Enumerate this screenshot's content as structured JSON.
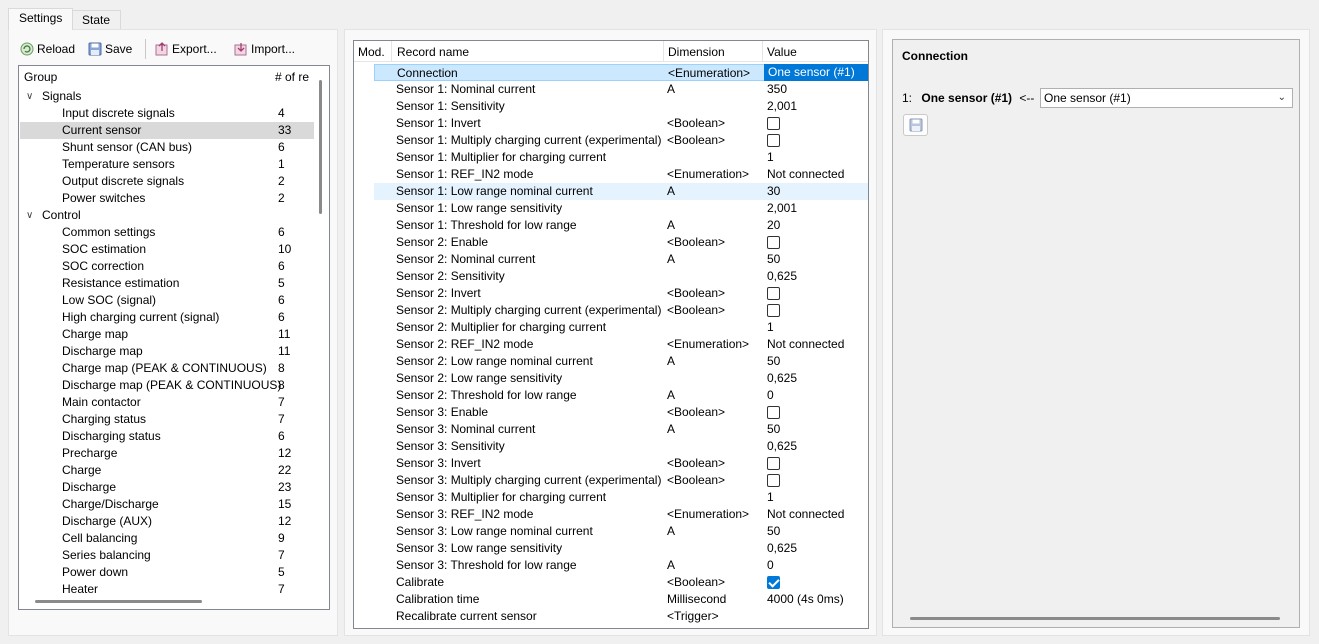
{
  "tabs": [
    {
      "label": "Settings",
      "active": true
    },
    {
      "label": "State",
      "active": false
    }
  ],
  "toolbar": {
    "reload": "Reload",
    "save": "Save",
    "export": "Export...",
    "import": "Import..."
  },
  "tree": {
    "col_group": "Group",
    "col_count": "# of re",
    "rows": [
      {
        "label": "Signals",
        "count": "",
        "level": 0,
        "expanded": true
      },
      {
        "label": "Input discrete signals",
        "count": "4",
        "level": 1
      },
      {
        "label": "Current sensor",
        "count": "33",
        "level": 1,
        "selected": true
      },
      {
        "label": "Shunt sensor (CAN bus)",
        "count": "6",
        "level": 1
      },
      {
        "label": "Temperature sensors",
        "count": "1",
        "level": 1
      },
      {
        "label": "Output discrete signals",
        "count": "2",
        "level": 1
      },
      {
        "label": "Power switches",
        "count": "2",
        "level": 1
      },
      {
        "label": "Control",
        "count": "",
        "level": 0,
        "expanded": true
      },
      {
        "label": "Common settings",
        "count": "6",
        "level": 1
      },
      {
        "label": "SOC estimation",
        "count": "10",
        "level": 1
      },
      {
        "label": "SOC correction",
        "count": "6",
        "level": 1
      },
      {
        "label": "Resistance estimation",
        "count": "5",
        "level": 1
      },
      {
        "label": "Low SOC (signal)",
        "count": "6",
        "level": 1
      },
      {
        "label": "High charging current (signal)",
        "count": "6",
        "level": 1
      },
      {
        "label": "Charge map",
        "count": "11",
        "level": 1
      },
      {
        "label": "Discharge map",
        "count": "11",
        "level": 1
      },
      {
        "label": "Charge map (PEAK & CONTINUOUS)",
        "count": "8",
        "level": 1
      },
      {
        "label": "Discharge map (PEAK & CONTINUOUS)",
        "count": "8",
        "level": 1
      },
      {
        "label": "Main contactor",
        "count": "7",
        "level": 1
      },
      {
        "label": "Charging status",
        "count": "7",
        "level": 1
      },
      {
        "label": "Discharging status",
        "count": "6",
        "level": 1
      },
      {
        "label": "Precharge",
        "count": "12",
        "level": 1
      },
      {
        "label": "Charge",
        "count": "22",
        "level": 1
      },
      {
        "label": "Discharge",
        "count": "23",
        "level": 1
      },
      {
        "label": "Charge/Discharge",
        "count": "15",
        "level": 1
      },
      {
        "label": "Discharge (AUX)",
        "count": "12",
        "level": 1
      },
      {
        "label": "Cell balancing",
        "count": "9",
        "level": 1
      },
      {
        "label": "Series balancing",
        "count": "7",
        "level": 1
      },
      {
        "label": "Power down",
        "count": "5",
        "level": 1
      },
      {
        "label": "Heater",
        "count": "7",
        "level": 1
      }
    ]
  },
  "grid": {
    "col_mod": "Mod.",
    "col_name": "Record name",
    "col_dim": "Dimension",
    "col_value": "Value",
    "rows": [
      {
        "name": "Connection",
        "dim": "<Enumeration>",
        "value": "One sensor (#1)",
        "selected": true
      },
      {
        "name": "Sensor 1: Nominal current",
        "dim": "A",
        "value": "350"
      },
      {
        "name": "Sensor 1: Sensitivity",
        "dim": "",
        "value": "2,001"
      },
      {
        "name": "Sensor 1: Invert",
        "dim": "<Boolean>",
        "checkbox": false
      },
      {
        "name": "Sensor 1: Multiply charging current (experimental)",
        "dim": "<Boolean>",
        "checkbox": false
      },
      {
        "name": "Sensor 1: Multiplier for charging current",
        "dim": "",
        "value": "1"
      },
      {
        "name": "Sensor 1: REF_IN2 mode",
        "dim": "<Enumeration>",
        "value": "Not connected"
      },
      {
        "name": "Sensor 1: Low range nominal current",
        "dim": "A",
        "value": "30",
        "hover": true
      },
      {
        "name": "Sensor 1: Low range sensitivity",
        "dim": "",
        "value": "2,001"
      },
      {
        "name": "Sensor 1: Threshold for low range",
        "dim": "A",
        "value": "20"
      },
      {
        "name": "Sensor 2: Enable",
        "dim": "<Boolean>",
        "checkbox": false
      },
      {
        "name": "Sensor 2: Nominal current",
        "dim": "A",
        "value": "50"
      },
      {
        "name": "Sensor 2: Sensitivity",
        "dim": "",
        "value": "0,625"
      },
      {
        "name": "Sensor 2: Invert",
        "dim": "<Boolean>",
        "checkbox": false
      },
      {
        "name": "Sensor 2: Multiply charging current (experimental)",
        "dim": "<Boolean>",
        "checkbox": false
      },
      {
        "name": "Sensor 2: Multiplier for charging current",
        "dim": "",
        "value": "1"
      },
      {
        "name": "Sensor 2: REF_IN2 mode",
        "dim": "<Enumeration>",
        "value": "Not connected"
      },
      {
        "name": "Sensor 2: Low range nominal current",
        "dim": "A",
        "value": "50"
      },
      {
        "name": "Sensor 2: Low range sensitivity",
        "dim": "",
        "value": "0,625"
      },
      {
        "name": "Sensor 2: Threshold for low range",
        "dim": "A",
        "value": "0"
      },
      {
        "name": "Sensor 3: Enable",
        "dim": "<Boolean>",
        "checkbox": false
      },
      {
        "name": "Sensor 3: Nominal current",
        "dim": "A",
        "value": "50"
      },
      {
        "name": "Sensor 3: Sensitivity",
        "dim": "",
        "value": "0,625"
      },
      {
        "name": "Sensor 3: Invert",
        "dim": "<Boolean>",
        "checkbox": false
      },
      {
        "name": "Sensor 3: Multiply charging current (experimental)",
        "dim": "<Boolean>",
        "checkbox": false
      },
      {
        "name": "Sensor 3: Multiplier for charging current",
        "dim": "",
        "value": "1"
      },
      {
        "name": "Sensor 3: REF_IN2 mode",
        "dim": "<Enumeration>",
        "value": "Not connected"
      },
      {
        "name": "Sensor 3: Low range nominal current",
        "dim": "A",
        "value": "50"
      },
      {
        "name": "Sensor 3: Low range sensitivity",
        "dim": "",
        "value": "0,625"
      },
      {
        "name": "Sensor 3: Threshold for low range",
        "dim": "A",
        "value": "0"
      },
      {
        "name": "Calibrate",
        "dim": "<Boolean>",
        "checkbox": true
      },
      {
        "name": "Calibration time",
        "dim": "Millisecond",
        "value": "4000 (4s 0ms)"
      },
      {
        "name": "Recalibrate current sensor",
        "dim": "<Trigger>",
        "value": ""
      }
    ]
  },
  "detail": {
    "title": "Connection",
    "index": "1:",
    "current": "One sensor (#1)",
    "arrow": "<--",
    "selected_option": "One sensor (#1)"
  },
  "colors": {
    "accent": "#0078d7",
    "selection_bg": "#cce8ff",
    "tree_selection": "#d9d9d9"
  }
}
